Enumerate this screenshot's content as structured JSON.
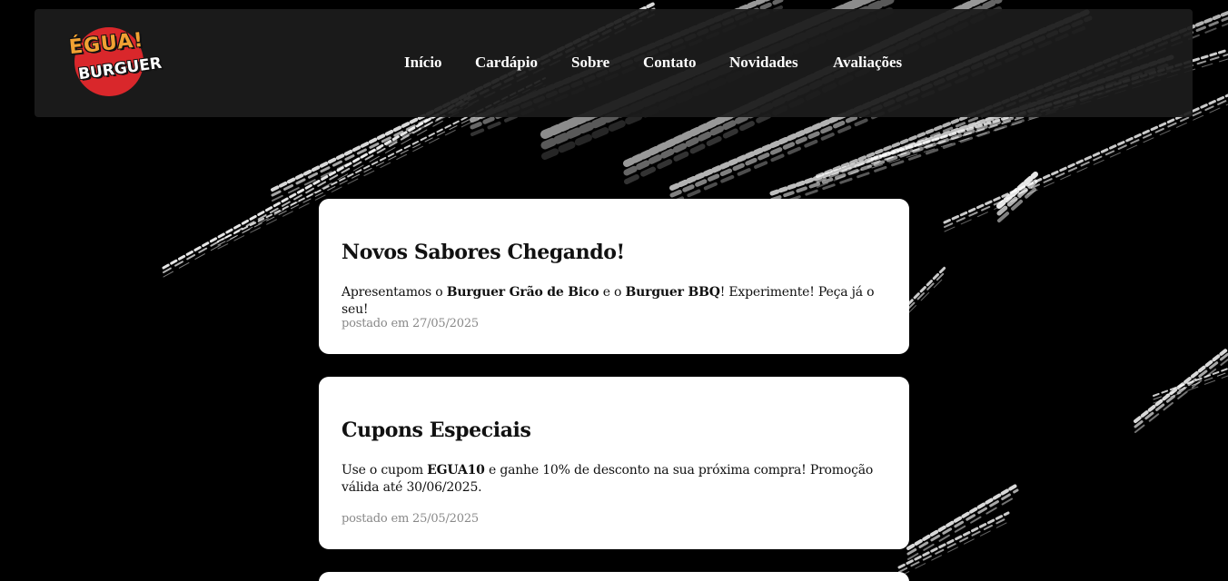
{
  "logo": {
    "line1": "ÉGUA!",
    "line2": "BURGUER"
  },
  "nav": [
    {
      "label": "Início",
      "name": "nav-inicio"
    },
    {
      "label": "Cardápio",
      "name": "nav-cardapio"
    },
    {
      "label": "Sobre",
      "name": "nav-sobre"
    },
    {
      "label": "Contato",
      "name": "nav-contato"
    },
    {
      "label": "Novidades",
      "name": "nav-novidades"
    },
    {
      "label": "Avaliações",
      "name": "nav-avaliacoes"
    }
  ],
  "posts": [
    {
      "title": "Novos Sabores Chegando!",
      "body": [
        "Apresentamos o ",
        "Burguer Grão de Bico",
        " e o ",
        "Burguer BBQ",
        "! Experimente! Peça já o seu!"
      ],
      "date": "postado em 27/05/2025"
    },
    {
      "title": "Cupons Especiais",
      "body": [
        "Use o cupom ",
        "EGUA10",
        " e ganhe 10% de desconto na sua próxima compra! Promoção válida até 30/06/2025."
      ],
      "date": "postado em 25/05/2025"
    }
  ],
  "colors": {
    "logo_red": "#d9272b",
    "logo_orange": "#f2a233",
    "navbar_bg": "#1c1c1c",
    "card_bg": "#ffffff",
    "date_gray": "#888888"
  }
}
